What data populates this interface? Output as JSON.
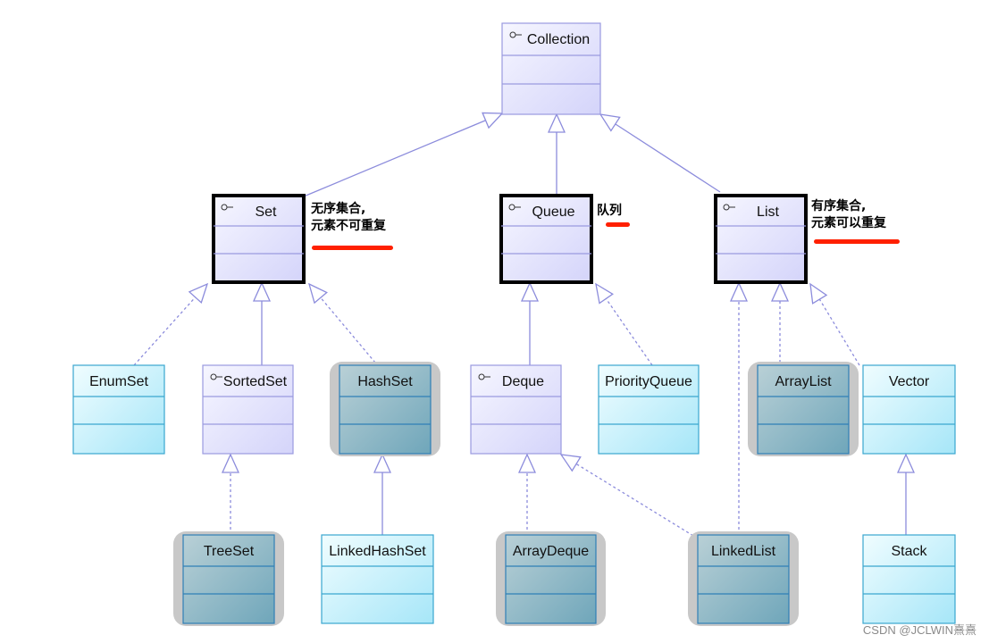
{
  "diagram": {
    "nodes": {
      "collection": {
        "label": "Collection",
        "kind": "interface"
      },
      "set": {
        "label": "Set",
        "kind": "interface-bold"
      },
      "queue": {
        "label": "Queue",
        "kind": "interface-bold"
      },
      "list": {
        "label": "List",
        "kind": "interface-bold"
      },
      "enumset": {
        "label": "EnumSet",
        "kind": "class"
      },
      "sortedset": {
        "label": "SortedSet",
        "kind": "interface"
      },
      "hashset": {
        "label": "HashSet",
        "kind": "highlight"
      },
      "deque": {
        "label": "Deque",
        "kind": "interface"
      },
      "priorityqueue": {
        "label": "PriorityQueue",
        "kind": "class"
      },
      "arraylist": {
        "label": "ArrayList",
        "kind": "highlight"
      },
      "vector": {
        "label": "Vector",
        "kind": "class"
      },
      "treeset": {
        "label": "TreeSet",
        "kind": "highlight"
      },
      "linkedhashset": {
        "label": "LinkedHashSet",
        "kind": "class"
      },
      "arraydeque": {
        "label": "ArrayDeque",
        "kind": "highlight"
      },
      "linkedlist": {
        "label": "LinkedList",
        "kind": "highlight"
      },
      "stack": {
        "label": "Stack",
        "kind": "class"
      }
    },
    "edges": [
      {
        "from": "set",
        "to": "collection",
        "style": "solid"
      },
      {
        "from": "queue",
        "to": "collection",
        "style": "solid"
      },
      {
        "from": "list",
        "to": "collection",
        "style": "solid"
      },
      {
        "from": "enumset",
        "to": "set",
        "style": "dashed"
      },
      {
        "from": "sortedset",
        "to": "set",
        "style": "solid"
      },
      {
        "from": "hashset",
        "to": "set",
        "style": "dashed"
      },
      {
        "from": "deque",
        "to": "queue",
        "style": "solid"
      },
      {
        "from": "priorityqueue",
        "to": "queue",
        "style": "dashed"
      },
      {
        "from": "linkedlist",
        "to": "list",
        "style": "dashed"
      },
      {
        "from": "arraylist",
        "to": "list",
        "style": "dashed"
      },
      {
        "from": "vector",
        "to": "list",
        "style": "dashed"
      },
      {
        "from": "treeset",
        "to": "sortedset",
        "style": "dashed"
      },
      {
        "from": "linkedhashset",
        "to": "hashset",
        "style": "solid"
      },
      {
        "from": "arraydeque",
        "to": "deque",
        "style": "dashed"
      },
      {
        "from": "linkedlist",
        "to": "deque",
        "style": "dashed"
      },
      {
        "from": "stack",
        "to": "vector",
        "style": "solid"
      }
    ],
    "interface_icon": "interface-lollipop-icon",
    "colors": {
      "interface_border": "#9a9ae0",
      "class_border": "#3aa6cf",
      "highlight_shadow": "#c8c8c8",
      "annotation_underline": "#ff2000"
    }
  },
  "annotations": {
    "set_note": "无序集合,\n元素不可重复",
    "queue_note": "队列",
    "list_note": "有序集合,\n元素可以重复"
  },
  "watermark": "CSDN @JCLWIN熹熹"
}
